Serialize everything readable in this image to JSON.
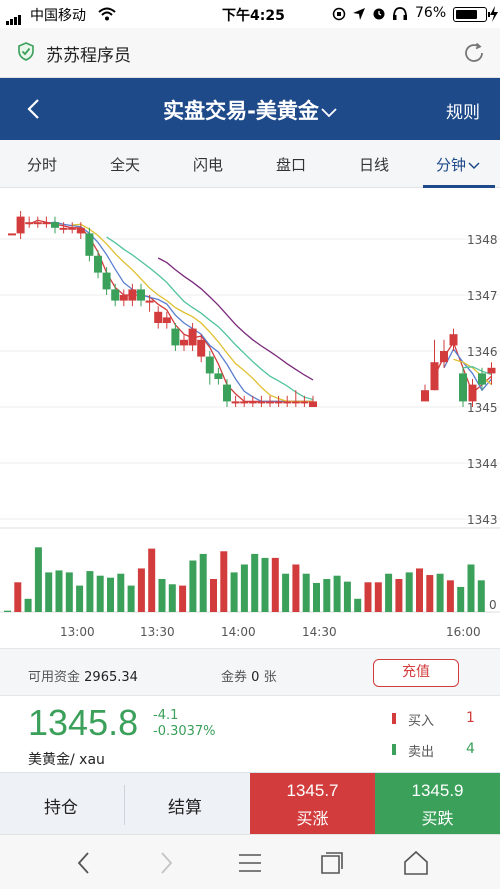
{
  "status_bar": {
    "carrier": "中国移动",
    "time": "下午4:25",
    "battery": "76%",
    "battery_level": 0.76
  },
  "app_header": {
    "title": "苏苏程序员"
  },
  "nav": {
    "title": "实盘交易-美黄金",
    "rule_label": "规则"
  },
  "tabs": [
    {
      "label": "分时"
    },
    {
      "label": "全天"
    },
    {
      "label": "闪电"
    },
    {
      "label": "盘口"
    },
    {
      "label": "日线"
    },
    {
      "label": "分钟",
      "active": true
    }
  ],
  "chart_data": {
    "type": "candlestick",
    "y_ticks": [
      "1348",
      "1347",
      "1346",
      "1345",
      "1344",
      "1343"
    ],
    "x_ticks": [
      "13:00",
      "13:30",
      "14:00",
      "14:30",
      "16:00"
    ],
    "volume_zero_label": "0",
    "ylim": [
      1343,
      1348.3
    ],
    "candles_left": [
      {
        "o": 1348.1,
        "c": 1348.1,
        "h": 1348.1,
        "l": 1348.1
      },
      {
        "o": 1348.1,
        "c": 1348.4,
        "h": 1348.5,
        "l": 1348.0
      },
      {
        "o": 1348.3,
        "c": 1348.3,
        "h": 1348.4,
        "l": 1348.2
      },
      {
        "o": 1348.3,
        "c": 1348.3,
        "h": 1348.4,
        "l": 1348.2
      },
      {
        "o": 1348.3,
        "c": 1348.3,
        "h": 1348.4,
        "l": 1348.2
      },
      {
        "o": 1348.3,
        "c": 1348.2,
        "h": 1348.4,
        "l": 1348.1
      },
      {
        "o": 1348.2,
        "c": 1348.2,
        "h": 1348.3,
        "l": 1348.1
      },
      {
        "o": 1348.2,
        "c": 1348.2,
        "h": 1348.3,
        "l": 1348.1
      },
      {
        "o": 1348.1,
        "c": 1348.2,
        "h": 1348.3,
        "l": 1348.0
      },
      {
        "o": 1348.1,
        "c": 1347.7,
        "h": 1348.2,
        "l": 1347.6
      },
      {
        "o": 1347.7,
        "c": 1347.4,
        "h": 1347.8,
        "l": 1347.3
      },
      {
        "o": 1347.4,
        "c": 1347.1,
        "h": 1347.5,
        "l": 1347.0
      },
      {
        "o": 1347.1,
        "c": 1346.9,
        "h": 1347.2,
        "l": 1346.8
      },
      {
        "o": 1346.9,
        "c": 1347.0,
        "h": 1347.1,
        "l": 1346.8
      },
      {
        "o": 1346.9,
        "c": 1347.1,
        "h": 1347.2,
        "l": 1346.8
      },
      {
        "o": 1347.1,
        "c": 1346.9,
        "h": 1347.2,
        "l": 1346.8
      },
      {
        "o": 1346.9,
        "c": 1346.9,
        "h": 1347.0,
        "l": 1346.7
      },
      {
        "o": 1346.5,
        "c": 1346.7,
        "h": 1346.8,
        "l": 1346.4
      },
      {
        "o": 1346.5,
        "c": 1346.6,
        "h": 1346.7,
        "l": 1346.4
      },
      {
        "o": 1346.4,
        "c": 1346.1,
        "h": 1346.5,
        "l": 1346.0
      },
      {
        "o": 1346.1,
        "c": 1346.2,
        "h": 1346.3,
        "l": 1346.0
      },
      {
        "o": 1346.1,
        "c": 1346.4,
        "h": 1346.5,
        "l": 1346.0
      },
      {
        "o": 1345.9,
        "c": 1346.2,
        "h": 1346.3,
        "l": 1345.8
      },
      {
        "o": 1345.9,
        "c": 1345.6,
        "h": 1346.0,
        "l": 1345.4
      },
      {
        "o": 1345.6,
        "c": 1345.5,
        "h": 1345.7,
        "l": 1345.4
      },
      {
        "o": 1345.4,
        "c": 1345.1,
        "h": 1345.5,
        "l": 1345.0
      },
      {
        "o": 1345.1,
        "c": 1345.1,
        "h": 1345.2,
        "l": 1345.0
      },
      {
        "o": 1345.1,
        "c": 1345.1,
        "h": 1345.2,
        "l": 1345.0
      },
      {
        "o": 1345.1,
        "c": 1345.1,
        "h": 1345.2,
        "l": 1345.0
      },
      {
        "o": 1345.1,
        "c": 1345.1,
        "h": 1345.2,
        "l": 1345.0
      },
      {
        "o": 1345.1,
        "c": 1345.1,
        "h": 1345.2,
        "l": 1345.0
      },
      {
        "o": 1345.1,
        "c": 1345.1,
        "h": 1345.2,
        "l": 1345.0
      },
      {
        "o": 1345.1,
        "c": 1345.1,
        "h": 1345.2,
        "l": 1345.0
      },
      {
        "o": 1345.1,
        "c": 1345.1,
        "h": 1345.3,
        "l": 1345.0
      },
      {
        "o": 1345.1,
        "c": 1345.1,
        "h": 1345.2,
        "l": 1345.0
      },
      {
        "o": 1345.0,
        "c": 1345.1,
        "h": 1345.2,
        "l": 1345.0
      }
    ],
    "candles_right": [
      {
        "o": 1345.1,
        "c": 1345.3,
        "h": 1345.4,
        "l": 1345.1
      },
      {
        "o": 1345.3,
        "c": 1345.8,
        "h": 1346.2,
        "l": 1345.3
      },
      {
        "o": 1345.8,
        "c": 1346.0,
        "h": 1346.2,
        "l": 1345.7
      },
      {
        "o": 1346.1,
        "c": 1346.3,
        "h": 1346.4,
        "l": 1346.0
      },
      {
        "o": 1345.6,
        "c": 1345.1,
        "h": 1345.7,
        "l": 1345.0
      },
      {
        "o": 1345.1,
        "c": 1345.4,
        "h": 1345.5,
        "l": 1345.0
      },
      {
        "o": 1345.6,
        "c": 1345.4,
        "h": 1345.7,
        "l": 1345.3
      },
      {
        "o": 1345.6,
        "c": 1345.7,
        "h": 1345.8,
        "l": 1345.4
      }
    ],
    "volumes": [
      {
        "v": 0.02,
        "up": false
      },
      {
        "v": 0.45,
        "up": true
      },
      {
        "v": 0.2,
        "up": false
      },
      {
        "v": 0.98,
        "up": false
      },
      {
        "v": 0.6,
        "up": false
      },
      {
        "v": 0.63,
        "up": false
      },
      {
        "v": 0.6,
        "up": false
      },
      {
        "v": 0.4,
        "up": false
      },
      {
        "v": 0.62,
        "up": false
      },
      {
        "v": 0.55,
        "up": false
      },
      {
        "v": 0.52,
        "up": false
      },
      {
        "v": 0.58,
        "up": false
      },
      {
        "v": 0.4,
        "up": false
      },
      {
        "v": 0.66,
        "up": true
      },
      {
        "v": 0.96,
        "up": true
      },
      {
        "v": 0.5,
        "up": false
      },
      {
        "v": 0.42,
        "up": false
      },
      {
        "v": 0.4,
        "up": true
      },
      {
        "v": 0.78,
        "up": false
      },
      {
        "v": 0.88,
        "up": false
      },
      {
        "v": 0.5,
        "up": true
      },
      {
        "v": 0.92,
        "up": true
      },
      {
        "v": 0.6,
        "up": false
      },
      {
        "v": 0.72,
        "up": false
      },
      {
        "v": 0.88,
        "up": false
      },
      {
        "v": 0.82,
        "up": false
      },
      {
        "v": 0.82,
        "up": true
      },
      {
        "v": 0.58,
        "up": false
      },
      {
        "v": 0.72,
        "up": true
      },
      {
        "v": 0.58,
        "up": false
      },
      {
        "v": 0.44,
        "up": false
      },
      {
        "v": 0.5,
        "up": false
      },
      {
        "v": 0.55,
        "up": false
      },
      {
        "v": 0.46,
        "up": false
      },
      {
        "v": 0.2,
        "up": false
      },
      {
        "v": 0.45,
        "up": true
      },
      {
        "v": 0.45,
        "up": true
      },
      {
        "v": 0.58,
        "up": false
      },
      {
        "v": 0.5,
        "up": true
      },
      {
        "v": 0.6,
        "up": false
      },
      {
        "v": 0.66,
        "up": true
      },
      {
        "v": 0.56,
        "up": true
      },
      {
        "v": 0.58,
        "up": false
      },
      {
        "v": 0.48,
        "up": true
      },
      {
        "v": 0.38,
        "up": false
      },
      {
        "v": 0.72,
        "up": false
      },
      {
        "v": 0.48,
        "up": false
      }
    ],
    "ma_colors": [
      "#d23c3c",
      "#5a7fd0",
      "#e0c030",
      "#4fc39a",
      "#7a2a7a"
    ]
  },
  "account": {
    "funds_label": "可用资金",
    "funds_value": "2965.34",
    "coupon_label": "金券",
    "coupon_value": "0",
    "coupon_unit": "张",
    "recharge_label": "充值"
  },
  "quote": {
    "price": "1345.8",
    "change": "-4.1",
    "change_pct": "-0.3037%",
    "name": "美黄金/ xau",
    "buy_label": "买入",
    "buy_count": "1",
    "sell_label": "卖出",
    "sell_count": "4"
  },
  "trade": {
    "position_label": "持仓",
    "settle_label": "结算",
    "up_price": "1345.7",
    "up_label": "买涨",
    "down_price": "1345.9",
    "down_label": "买跌"
  },
  "colors": {
    "red": "#d23c3c",
    "green": "#3aa05a",
    "nav_blue": "#1f4a8a"
  }
}
